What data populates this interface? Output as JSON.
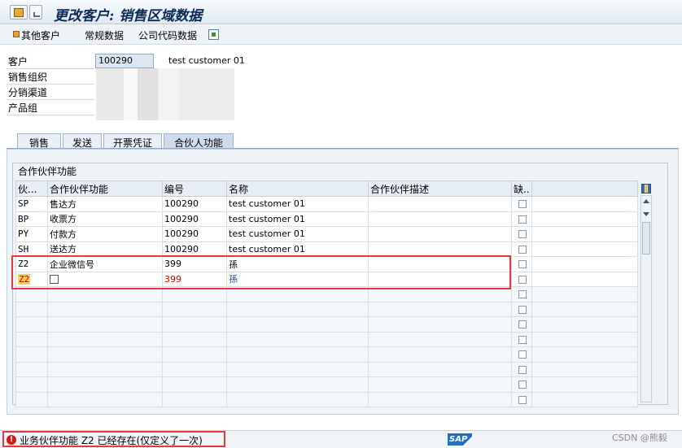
{
  "window": {
    "title": "更改客户: 销售区域数据"
  },
  "toolbar": {
    "other_customer": "其他客户",
    "general_data": "常规数据",
    "company_code_data": "公司代码数据"
  },
  "header": {
    "customer_label": "客户",
    "customer_number": "100290",
    "customer_name": "test customer 01",
    "sales_org_label": "销售组织",
    "distribution_channel_label": "分销渠道",
    "division_label": "产品组"
  },
  "tabs": [
    {
      "label": "销售"
    },
    {
      "label": "发送"
    },
    {
      "label": "开票凭证"
    },
    {
      "label": "合伙人功能",
      "active": true
    }
  ],
  "group": {
    "title": "合作伙伴功能"
  },
  "table": {
    "columns": [
      "伙...",
      "合作伙伴功能",
      "编号",
      "名称",
      "合作伙伴描述",
      "缺.."
    ],
    "rows": [
      {
        "code": "SP",
        "function": "售达方",
        "number": "100290",
        "name": "test customer 01",
        "desc": ""
      },
      {
        "code": "BP",
        "function": "收票方",
        "number": "100290",
        "name": "test customer 01",
        "desc": ""
      },
      {
        "code": "PY",
        "function": "付款方",
        "number": "100290",
        "name": "test customer 01",
        "desc": ""
      },
      {
        "code": "SH",
        "function": "送达方",
        "number": "100290",
        "name": "test customer 01",
        "desc": ""
      },
      {
        "code": "Z2",
        "function": "企业微信号",
        "number": "399",
        "name": "孫",
        "desc": ""
      }
    ],
    "edit_row": {
      "code": "Z2",
      "function": "",
      "number": "399",
      "name": "孫",
      "desc": ""
    },
    "empty_rows": 8
  },
  "status": {
    "message": "业务伙伴功能 Z2 已经存在(仅定义了一次)",
    "error_symbol": "!",
    "sap_logo": "SAP",
    "watermark": "CSDN @熊毅"
  },
  "colors": {
    "error_red": "#e33b3b",
    "highlight_yellow": "#ffd24d",
    "sap_blue": "#1f6fc5"
  }
}
